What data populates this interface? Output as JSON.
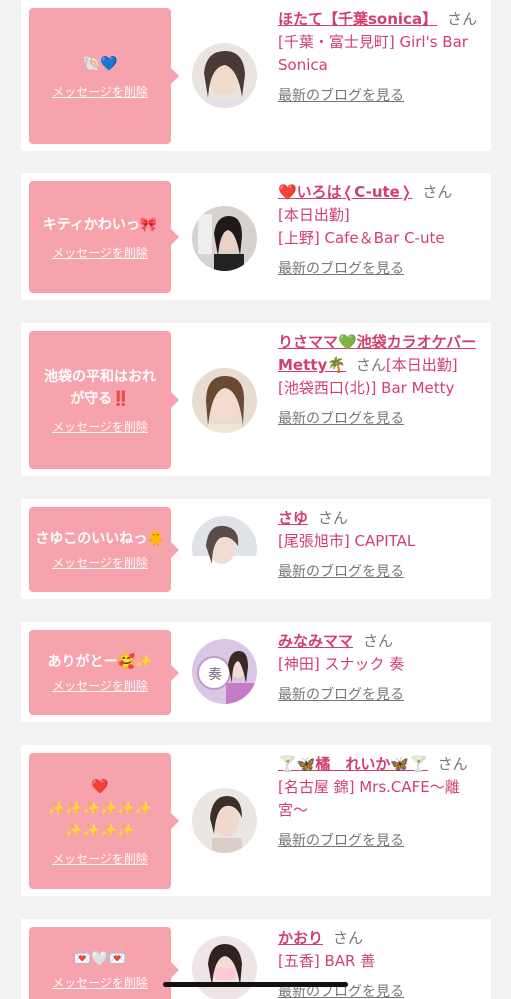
{
  "messages": [
    {
      "bubble": "🐚💙",
      "delete": "メッセージを削除",
      "name": "ほたて【千葉sonica】",
      "san": "さん",
      "lines": [
        "[千葉・富士見町] Girl's Bar Sonica"
      ],
      "blog": "最新のブログを見る"
    },
    {
      "bubble": "キティかわいっ🎀",
      "delete": "メッセージを削除",
      "name": "❤️いろは❬C-ute❭",
      "san": "さん",
      "lines": [
        "[本日出勤]",
        "[上野] Cafe＆Bar C-ute"
      ],
      "blog": "最新のブログを見る"
    },
    {
      "bubble": "池袋の平和はおれが守る‼️",
      "delete": "メッセージを削除",
      "name": "りさママ💚池袋カラオケバーMetty🌴",
      "san": "さん",
      "lines": [
        "[本日出勤]",
        "[池袋西口(北)] Bar Metty"
      ],
      "blog": "最新のブログを見る"
    },
    {
      "bubble": "さゆこのいいねっ🐥",
      "delete": "メッセージを削除",
      "name": "さゆ",
      "san": "さん",
      "lines": [
        "[尾張旭市] CAPITAL"
      ],
      "blog": "最新のブログを見る"
    },
    {
      "bubble": "ありがとー🥰✨",
      "delete": "メッセージを削除",
      "name": "みなみママ",
      "san": "さん",
      "lines": [
        "[神田] スナック 奏"
      ],
      "blog": "最新のブログを見る"
    },
    {
      "bubble": "❤️\n✨✨✨✨✨✨\n✨✨✨✨",
      "delete": "メッセージを削除",
      "name": "🍸🦋橘　れいか🦋🍸",
      "san": "さん",
      "lines": [
        "[名古屋 錦] Mrs.CAFE〜離宮〜"
      ],
      "blog": "最新のブログを見る"
    },
    {
      "bubble": "💌🤍💌",
      "delete": "メッセージを削除",
      "name": "かおり",
      "san": "さん",
      "lines": [
        "[五香] BAR 善"
      ],
      "blog": "最新のブログを見る"
    }
  ],
  "colors": {
    "bubble": "#f7a3ad",
    "accent": "#d23f6b",
    "muted": "#777777",
    "background": "#f2f2f2"
  },
  "icons": {
    "avatar": "user-photo-avatar",
    "bubble_pointer": "speech-bubble-arrow"
  }
}
